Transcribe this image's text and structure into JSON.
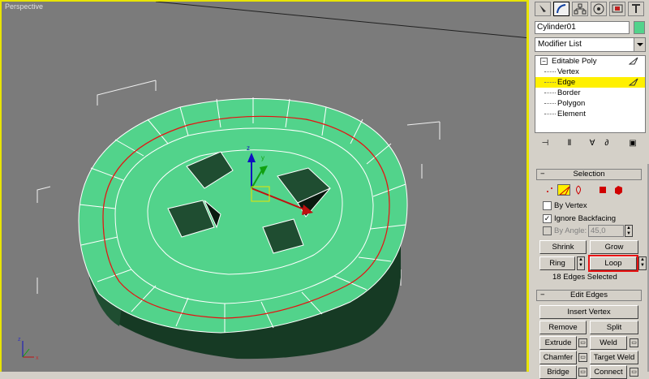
{
  "viewport": {
    "label": "Perspective",
    "axis_x": "x",
    "axis_y": "y",
    "axis_z": "z"
  },
  "panel": {
    "tabs": [
      "create-icon",
      "modify-icon",
      "hierarchy-icon",
      "motion-icon",
      "display-icon",
      "utilities-icon"
    ],
    "object_name": "Cylinder01",
    "object_color": "#52d38b",
    "modifier_list_label": "Modifier List",
    "stack": {
      "root": "Editable Poly",
      "items": [
        "Vertex",
        "Edge",
        "Border",
        "Polygon",
        "Element"
      ],
      "selected": "Edge",
      "highlight_color": "#fff000"
    }
  },
  "selection": {
    "title": "Selection",
    "by_vertex": "By Vertex",
    "ignore_backfacing": "Ignore Backfacing",
    "by_angle": "By Angle:",
    "angle_value": "45,0",
    "shrink": "Shrink",
    "grow": "Grow",
    "ring": "Ring",
    "loop": "Loop",
    "status": "18 Edges Selected"
  },
  "edit_edges": {
    "title": "Edit Edges",
    "insert_vertex": "Insert Vertex",
    "remove": "Remove",
    "split": "Split",
    "extrude": "Extrude",
    "weld": "Weld",
    "chamfer": "Chamfer",
    "target_weld": "Target Weld",
    "bridge": "Bridge",
    "connect": "Connect"
  },
  "colors": {
    "mesh": "#52d38b",
    "selection_highlight": "#e81010",
    "active_viewport_border": "#e8e400"
  }
}
